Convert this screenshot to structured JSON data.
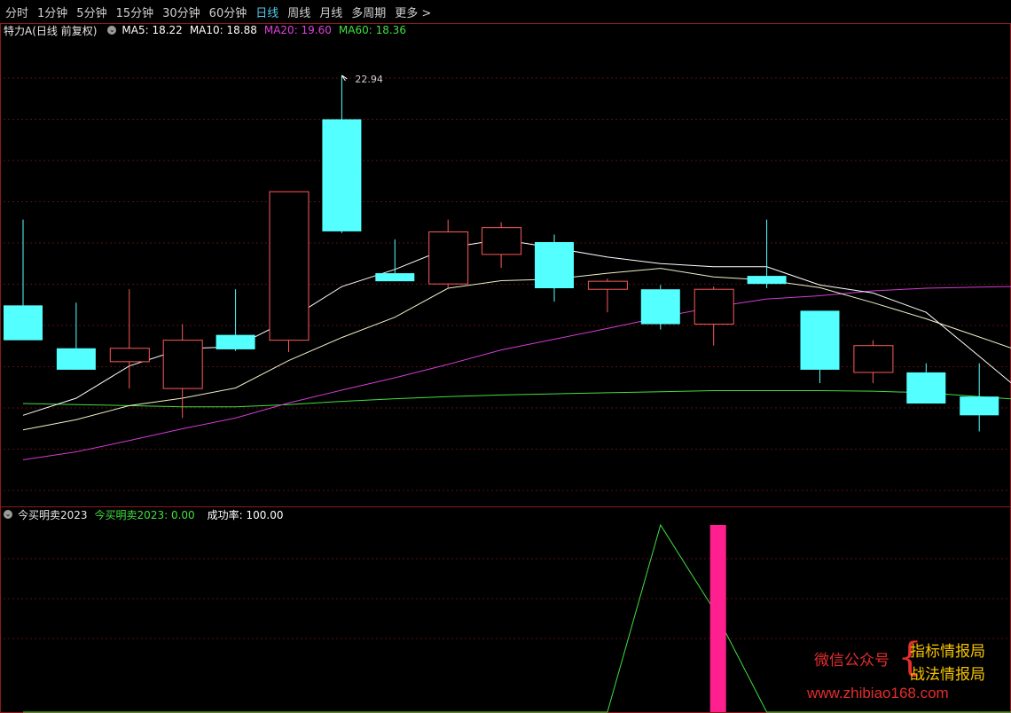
{
  "toolbar": {
    "tabs": [
      "分时",
      "1分钟",
      "5分钟",
      "15分钟",
      "30分钟",
      "60分钟",
      "日线",
      "周线",
      "月线",
      "多周期",
      "更多 >"
    ],
    "active_index": 6
  },
  "main_legend": {
    "title": "特力A(日线 前复权)",
    "ma5": "MA5: 18.22",
    "ma10": "MA10: 18.88",
    "ma20": "MA20: 19.60",
    "ma60": "MA60: 18.36",
    "colors": {
      "ma5": "#ffffff",
      "ma10": "#ffffff",
      "ma20": "#e040e0",
      "ma60": "#40e040"
    }
  },
  "sub_legend": {
    "name": "今买明卖2023",
    "value": "今买明卖2023: 0.00",
    "rate": "成功率: 100.00",
    "colors": {
      "value": "#40e040",
      "rate": "#ffffff"
    }
  },
  "chart_data": {
    "type": "candlestick",
    "price_range": [
      15.2,
      23.6
    ],
    "high_label": "22.94",
    "candles": [
      {
        "o": 18.65,
        "h": 20.25,
        "l": 18.0,
        "c": 18.0
      },
      {
        "o": 17.85,
        "h": 18.7,
        "l": 17.48,
        "c": 17.45
      },
      {
        "o": 17.6,
        "h": 18.95,
        "l": 17.1,
        "c": 17.85
      },
      {
        "o": 17.1,
        "h": 18.3,
        "l": 16.55,
        "c": 18.0
      },
      {
        "o": 18.1,
        "h": 18.95,
        "l": 17.8,
        "c": 17.83
      },
      {
        "o": 18.0,
        "h": 20.77,
        "l": 17.78,
        "c": 20.77
      },
      {
        "o": 22.12,
        "h": 22.94,
        "l": 20.0,
        "c": 20.03
      },
      {
        "o": 19.25,
        "h": 19.88,
        "l": 19.1,
        "c": 19.1
      },
      {
        "o": 19.05,
        "h": 20.25,
        "l": 18.95,
        "c": 20.02
      },
      {
        "o": 19.6,
        "h": 20.2,
        "l": 19.35,
        "c": 20.1
      },
      {
        "o": 19.83,
        "h": 19.97,
        "l": 18.72,
        "c": 18.97
      },
      {
        "o": 18.95,
        "h": 19.15,
        "l": 18.52,
        "c": 19.1
      },
      {
        "o": 18.95,
        "h": 19.03,
        "l": 18.2,
        "c": 18.3
      },
      {
        "o": 18.3,
        "h": 19.0,
        "l": 17.9,
        "c": 18.95
      },
      {
        "o": 19.2,
        "h": 20.25,
        "l": 18.97,
        "c": 19.05
      },
      {
        "o": 18.55,
        "h": 18.55,
        "l": 17.2,
        "c": 17.45
      },
      {
        "o": 17.4,
        "h": 18.0,
        "l": 17.2,
        "c": 17.9
      },
      {
        "o": 17.4,
        "h": 17.57,
        "l": 16.82,
        "c": 16.82
      },
      {
        "o": 16.95,
        "h": 17.57,
        "l": 16.3,
        "c": 16.6
      }
    ],
    "ma5": [
      16.6,
      16.92,
      17.52,
      17.84,
      17.88,
      18.38,
      19.0,
      19.32,
      19.72,
      19.88,
      19.72,
      19.55,
      19.43,
      19.37,
      19.37,
      19.03,
      18.88,
      18.52,
      17.7
    ],
    "ma10": [
      16.33,
      16.52,
      16.78,
      16.92,
      17.11,
      17.62,
      18.05,
      18.43,
      18.97,
      19.11,
      19.14,
      19.25,
      19.34,
      19.18,
      19.12,
      18.98,
      18.7,
      18.4,
      18.06
    ],
    "ma20": [
      15.77,
      15.92,
      16.13,
      16.35,
      16.55,
      16.83,
      17.07,
      17.3,
      17.55,
      17.82,
      18.02,
      18.22,
      18.43,
      18.62,
      18.77,
      18.83,
      18.92,
      18.97,
      18.99
    ],
    "ma60": [
      16.82,
      16.8,
      16.78,
      16.76,
      16.76,
      16.8,
      16.86,
      16.91,
      16.95,
      16.98,
      17.0,
      17.02,
      17.04,
      17.06,
      17.06,
      17.06,
      17.05,
      17.02,
      16.95
    ],
    "indicator": {
      "line": [
        0,
        0,
        0,
        0,
        0,
        0,
        0,
        0,
        0,
        0,
        0,
        0,
        1,
        0.55,
        0,
        0,
        0,
        0,
        0
      ],
      "signal_index": 13,
      "signal_value": 1
    }
  }
}
